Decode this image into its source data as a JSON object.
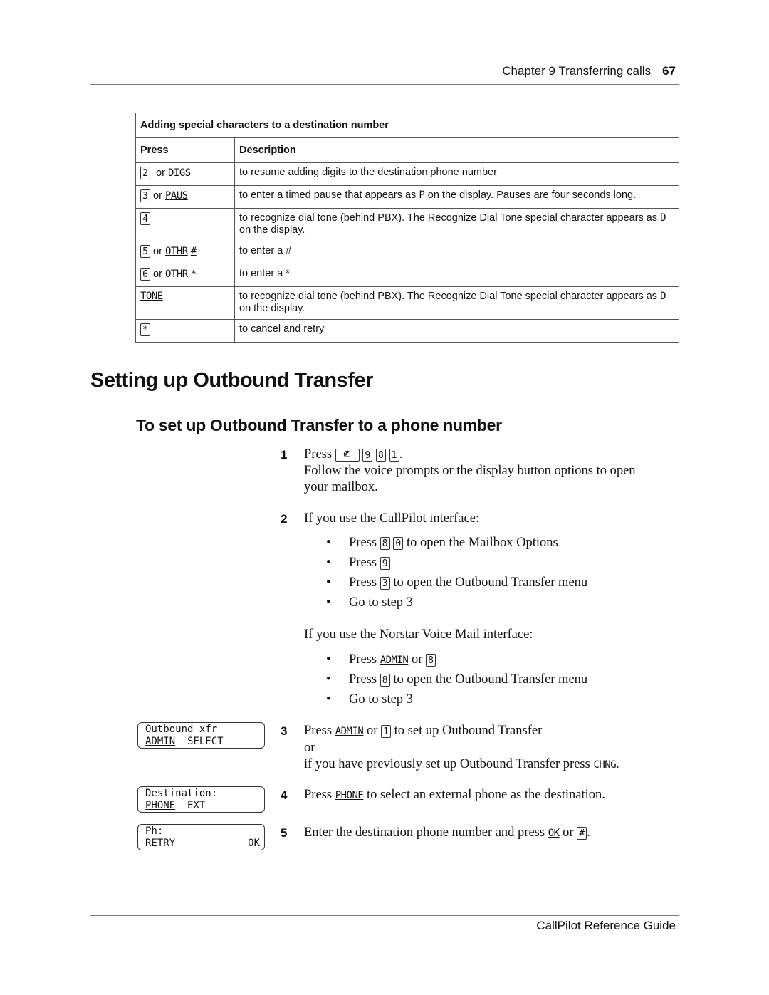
{
  "header": {
    "chapter": "Chapter 9  Transferring calls",
    "page_number": "67"
  },
  "table": {
    "caption": "Adding special characters to a destination number",
    "columns": [
      "Press",
      "Description"
    ],
    "rows": [
      {
        "key": "2",
        "or": "or",
        "softkey": "DIGS",
        "extra": "",
        "description": "to resume adding digits to the destination phone number"
      },
      {
        "key": "3",
        "or": "or",
        "softkey": "PAUS",
        "extra": "",
        "description_a": "to enter a timed pause that appears as ",
        "display_char": "P",
        "description_b": " on the display. Pauses are four seconds long."
      },
      {
        "key": "4",
        "description_a": "to recognize dial tone (behind PBX). The Recognize Dial Tone special character appears as ",
        "display_char": "D",
        "description_b": " on the display."
      },
      {
        "key": "5",
        "or": "or",
        "softkey": "OTHR",
        "extra": "#",
        "description": "to enter a #"
      },
      {
        "key": "6",
        "or": "or",
        "softkey": "OTHR",
        "extra": "*",
        "description": "to enter a *"
      },
      {
        "softkey": "TONE",
        "description_a": "to recognize dial tone (behind PBX). The Recognize Dial Tone special character appears as ",
        "display_char": "D",
        "description_b": " on the display."
      },
      {
        "key": "*",
        "description": "to cancel and retry"
      }
    ]
  },
  "section_title": "Setting up Outbound Transfer",
  "procedure_title": "To set up Outbound Transfer to a phone number",
  "steps": {
    "s1": {
      "num": "1",
      "press": "Press",
      "keys": [
        "9",
        "8",
        "1"
      ],
      "feature_key_icon": "feature-key",
      "line2": "Follow the voice prompts or the display button options to open",
      "line3": "your mailbox."
    },
    "s2": {
      "num": "2",
      "intro": "If you use the CallPilot interface:",
      "callpilot": [
        {
          "a": "Press",
          "keys": [
            "8",
            "0"
          ],
          "b": "to open the Mailbox Options"
        },
        {
          "a": "Press",
          "keys": [
            "9"
          ],
          "b": ""
        },
        {
          "a": "Press",
          "keys": [
            "3"
          ],
          "b": "to open the Outbound Transfer menu"
        },
        {
          "a": "Go to step 3"
        }
      ],
      "norstar_intro": "If you use the Norstar Voice Mail interface:",
      "norstar": [
        {
          "a": "Press",
          "softkey": "ADMIN",
          "or": "or",
          "keys": [
            "8"
          ]
        },
        {
          "a": "Press",
          "keys": [
            "8"
          ],
          "b": "to open the Outbound Transfer menu"
        },
        {
          "a": "Go to step 3"
        }
      ]
    },
    "s3": {
      "num": "3",
      "a": "Press",
      "softkey": "ADMIN",
      "or": "or",
      "key": "1",
      "b": "to set up Outbound Transfer",
      "line2": "or",
      "line3": "if you have previously set up Outbound Transfer press",
      "softkey2": "CHNG",
      "end": "."
    },
    "s4": {
      "num": "4",
      "a": "Press",
      "softkey": "PHONE",
      "b": "to select an external phone as the destination."
    },
    "s5": {
      "num": "5",
      "a": "Enter the destination phone number and press",
      "softkey": "OK",
      "or": "or",
      "key": "#",
      "end": "."
    }
  },
  "displays": [
    {
      "line1": "Outbound xfr",
      "left": "ADMIN",
      "mid": "SELECT",
      "right": ""
    },
    {
      "line1": "Destination:",
      "left": "PHONE",
      "mid": "EXT",
      "right": ""
    },
    {
      "line1": "Ph:",
      "left": "RETRY",
      "mid": "",
      "right": "OK"
    }
  ],
  "bullet": "•",
  "footer": "CallPilot Reference Guide"
}
